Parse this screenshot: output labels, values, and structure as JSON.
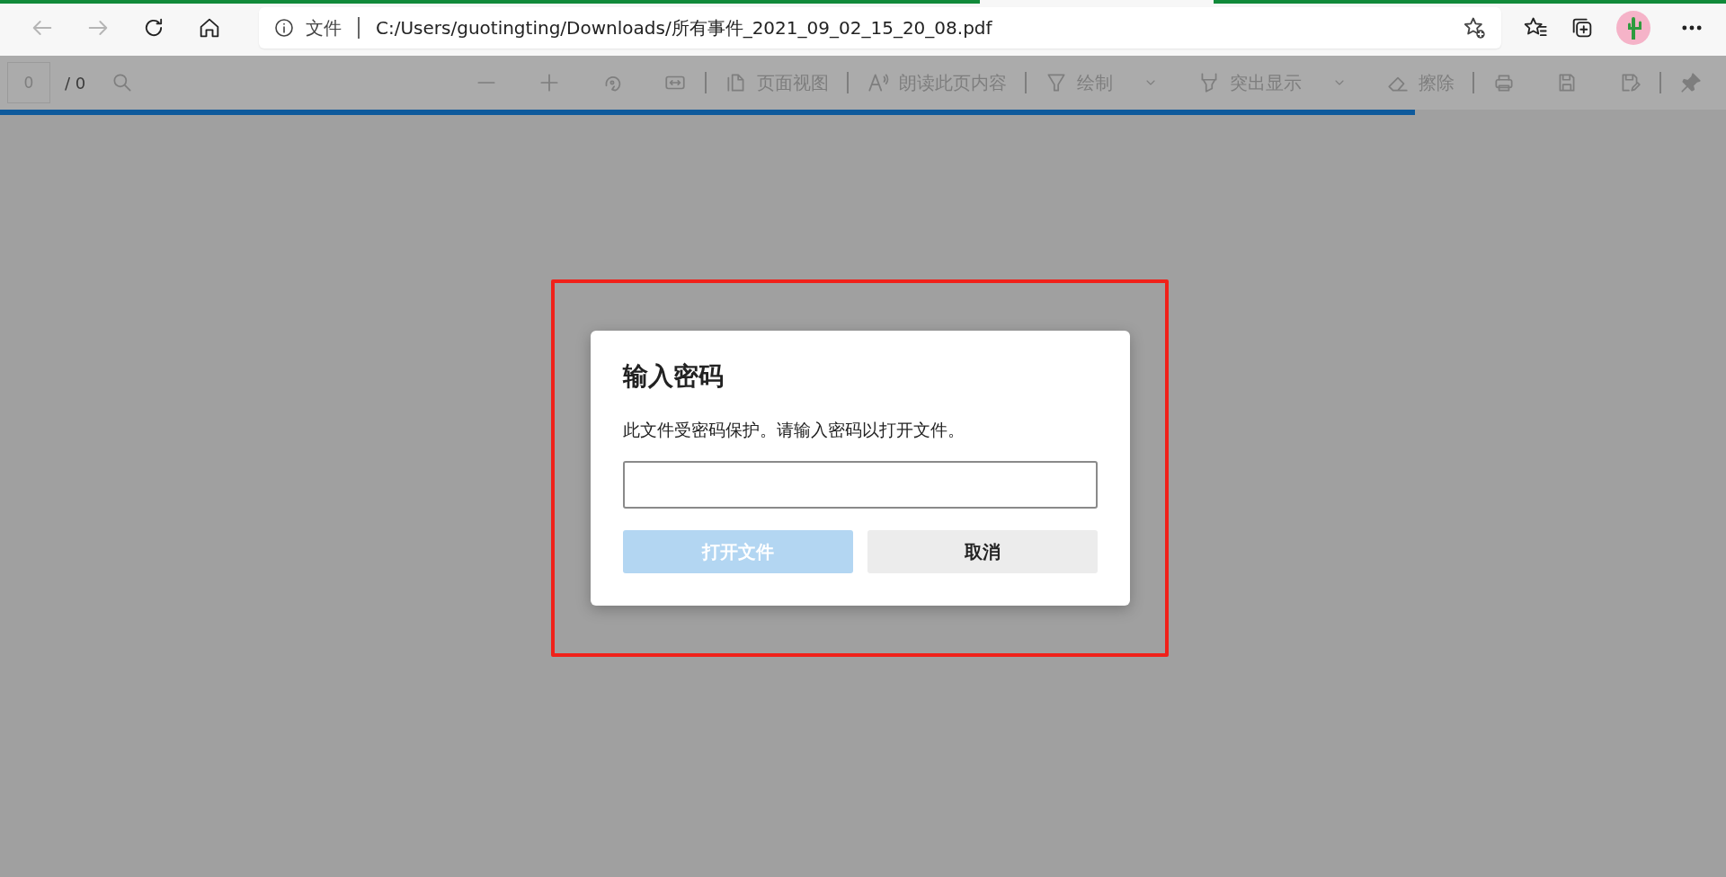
{
  "browser": {
    "nav": [
      {
        "kind": "back",
        "disabled": true
      },
      {
        "kind": "forward",
        "disabled": true
      },
      {
        "kind": "refresh",
        "disabled": false
      },
      {
        "kind": "home",
        "disabled": false
      }
    ],
    "address": {
      "prefix": "文件",
      "url": "C:/Users/guotingting/Downloads/所有事件_2021_09_02_15_20_08.pdf"
    }
  },
  "pdf_toolbar": {
    "page_field": "0",
    "page_total": "/ 0",
    "groups": [
      [
        {
          "kind": "zoom_out"
        },
        {
          "kind": "zoom_in"
        },
        {
          "kind": "rotate"
        },
        {
          "kind": "fit_width"
        }
      ],
      [
        {
          "kind": "page_view",
          "label": "页面视图"
        }
      ],
      [
        {
          "kind": "read_aloud",
          "label": "朗读此页内容"
        }
      ],
      [
        {
          "kind": "draw",
          "label": "绘制",
          "dropdown": true
        },
        {
          "kind": "highlight",
          "label": "突出显示",
          "dropdown": true
        },
        {
          "kind": "erase",
          "label": "擦除",
          "dropdown": false
        }
      ],
      [
        {
          "kind": "print"
        },
        {
          "kind": "save"
        },
        {
          "kind": "save_as"
        }
      ],
      [
        {
          "kind": "pin"
        }
      ]
    ]
  },
  "load_progress": {
    "level": 0.82
  },
  "dialog": {
    "title": "输入密码",
    "message": "此文件受密码保护。请输入密码以打开文件。",
    "buttons": [
      {
        "label": "打开文件",
        "kind": "primary",
        "disabled": true
      },
      {
        "label": "取消",
        "kind": "secondary",
        "disabled": false
      }
    ]
  }
}
